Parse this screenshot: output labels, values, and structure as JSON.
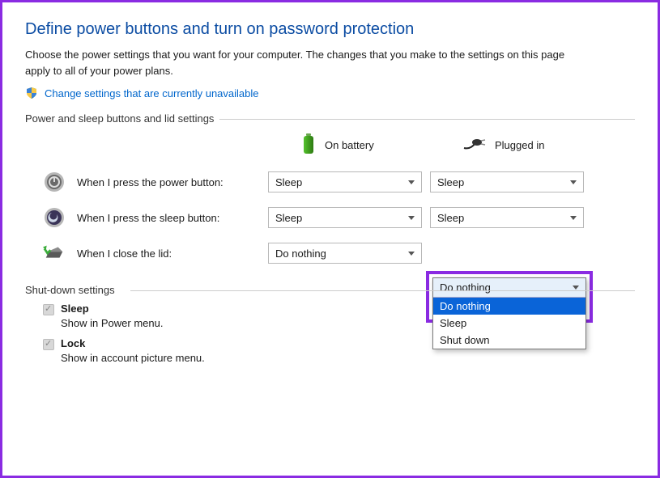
{
  "title": "Define power buttons and turn on password protection",
  "intro": "Choose the power settings that you want for your computer. The changes that you make to the settings on this page apply to all of your power plans.",
  "change_link": "Change settings that are currently unavailable",
  "section1_label": "Power and sleep buttons and lid settings",
  "columns": {
    "battery": "On battery",
    "plugged": "Plugged in"
  },
  "rows": {
    "power": {
      "label": "When I press the power button:",
      "battery_value": "Sleep",
      "plugged_value": "Sleep"
    },
    "sleep": {
      "label": "When I press the sleep button:",
      "battery_value": "Sleep",
      "plugged_value": "Sleep"
    },
    "lid": {
      "label": "When I close the lid:",
      "battery_value": "Do nothing",
      "plugged_value": "Do nothing"
    }
  },
  "lid_plugged_dropdown": {
    "selected_display": "Do nothing",
    "options": [
      "Do nothing",
      "Sleep",
      "Shut down"
    ],
    "highlighted_index": 0
  },
  "section2_label": "Shut-down settings",
  "shutdown": {
    "sleep": {
      "label": "Sleep",
      "desc": "Show in Power menu."
    },
    "lock": {
      "label": "Lock",
      "desc": "Show in account picture menu."
    }
  }
}
